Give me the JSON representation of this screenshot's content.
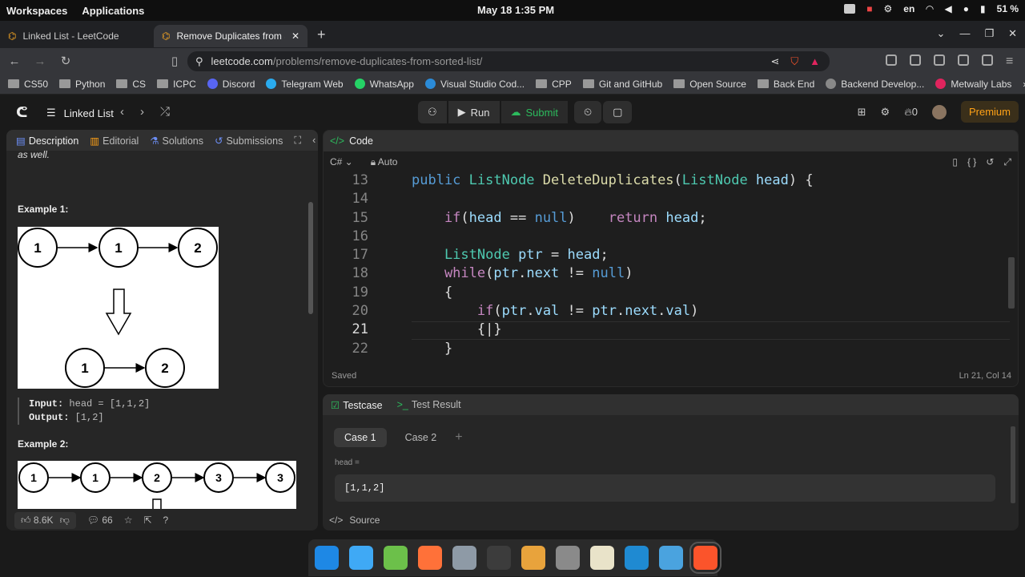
{
  "system": {
    "workspaces": "Workspaces",
    "applications": "Applications",
    "datetime": "May 18  1:35 PM",
    "lang": "en",
    "battery": "51 %"
  },
  "tabs": [
    {
      "title": "Linked List - LeetCode"
    },
    {
      "title": "Remove Duplicates from Sort"
    }
  ],
  "address": {
    "domain": "leetcode.com",
    "path": "/problems/remove-duplicates-from-sorted-list/"
  },
  "bookmarks": [
    {
      "label": "CS50",
      "icon": "folder"
    },
    {
      "label": "Python",
      "icon": "folder"
    },
    {
      "label": "CS",
      "icon": "folder"
    },
    {
      "label": "ICPC",
      "icon": "folder"
    },
    {
      "label": "Discord",
      "icon": "discord",
      "color": "#5865f2"
    },
    {
      "label": "Telegram Web",
      "icon": "telegram",
      "color": "#2aabee"
    },
    {
      "label": "WhatsApp",
      "icon": "whatsapp",
      "color": "#25d366"
    },
    {
      "label": "Visual Studio Cod...",
      "icon": "vscode",
      "color": "#2b8bd8"
    },
    {
      "label": "CPP",
      "icon": "folder"
    },
    {
      "label": "Git and GitHub",
      "icon": "folder"
    },
    {
      "label": "Open Source",
      "icon": "folder"
    },
    {
      "label": "Back End",
      "icon": "folder"
    },
    {
      "label": "Backend Develop...",
      "icon": "bd"
    },
    {
      "label": "Metwally Labs",
      "icon": "metwally",
      "color": "#e0245e"
    }
  ],
  "lc": {
    "list_label": "Linked List",
    "run": "Run",
    "submit": "Submit",
    "streak": "0",
    "premium": "Premium"
  },
  "left": {
    "tabs": [
      "Description",
      "Editorial",
      "Solutions",
      "Submissions"
    ],
    "text_top": "as well.",
    "ex1_title": "Example 1:",
    "ex1_nodes_top": [
      "1",
      "1",
      "2"
    ],
    "ex1_nodes_bottom": [
      "1",
      "2"
    ],
    "ex1_input_label": "Input:",
    "ex1_input": "head = [1,1,2]",
    "ex1_output_label": "Output:",
    "ex1_output": "[1,2]",
    "ex2_title": "Example 2:",
    "ex2_nodes": [
      "1",
      "1",
      "2",
      "3",
      "3"
    ],
    "likes": "8.6K",
    "comments": "66"
  },
  "code": {
    "header": "Code",
    "language": "C#",
    "mode": "Auto",
    "saved": "Saved",
    "position": "Ln 21, Col 14",
    "line_numbers": [
      "13",
      "14",
      "15",
      "16",
      "17",
      "18",
      "19",
      "20",
      "21",
      "22"
    ],
    "lines": [
      [
        {
          "t": "public ",
          "c": "kwb"
        },
        {
          "t": "ListNode ",
          "c": "ty"
        },
        {
          "t": "DeleteDuplicates",
          "c": "fn"
        },
        {
          "t": "(",
          "c": ""
        },
        {
          "t": "ListNode ",
          "c": "ty"
        },
        {
          "t": "head",
          "c": "vr"
        },
        {
          "t": ") {",
          "c": ""
        }
      ],
      [],
      [
        {
          "t": "    if",
          "c": "kw"
        },
        {
          "t": "(",
          "c": ""
        },
        {
          "t": "head",
          "c": "vr"
        },
        {
          "t": " == ",
          "c": ""
        },
        {
          "t": "null",
          "c": "kwb"
        },
        {
          "t": ")    ",
          "c": ""
        },
        {
          "t": "return ",
          "c": "kw"
        },
        {
          "t": "head",
          "c": "vr"
        },
        {
          "t": ";",
          "c": ""
        }
      ],
      [],
      [
        {
          "t": "    ListNode ",
          "c": "ty"
        },
        {
          "t": "ptr",
          "c": "vr"
        },
        {
          "t": " = ",
          "c": ""
        },
        {
          "t": "head",
          "c": "vr"
        },
        {
          "t": ";",
          "c": ""
        }
      ],
      [
        {
          "t": "    while",
          "c": "kw"
        },
        {
          "t": "(",
          "c": ""
        },
        {
          "t": "ptr",
          "c": "vr"
        },
        {
          "t": ".",
          "c": ""
        },
        {
          "t": "next",
          "c": "vr"
        },
        {
          "t": " != ",
          "c": ""
        },
        {
          "t": "null",
          "c": "kwb"
        },
        {
          "t": ")",
          "c": ""
        }
      ],
      [
        {
          "t": "    {",
          "c": ""
        }
      ],
      [
        {
          "t": "        if",
          "c": "kw"
        },
        {
          "t": "(",
          "c": ""
        },
        {
          "t": "ptr",
          "c": "vr"
        },
        {
          "t": ".",
          "c": ""
        },
        {
          "t": "val",
          "c": "vr"
        },
        {
          "t": " != ",
          "c": ""
        },
        {
          "t": "ptr",
          "c": "vr"
        },
        {
          "t": ".",
          "c": ""
        },
        {
          "t": "next",
          "c": "vr"
        },
        {
          "t": ".",
          "c": ""
        },
        {
          "t": "val",
          "c": "vr"
        },
        {
          "t": ")",
          "c": ""
        }
      ],
      [
        {
          "t": "        {|}",
          "c": ""
        }
      ],
      [
        {
          "t": "    }",
          "c": ""
        }
      ]
    ],
    "current_line": 8
  },
  "test": {
    "tab_testcase": "Testcase",
    "tab_result": "Test Result",
    "cases": [
      "Case 1",
      "Case 2"
    ],
    "label": "head =",
    "value": "[1,1,2]",
    "source": "Source"
  },
  "dock": [
    {
      "name": "search-app-icon",
      "color": "#1e88e5"
    },
    {
      "name": "software-center-icon",
      "color": "#3fa9f5"
    },
    {
      "name": "app-grid-icon",
      "color": "#6cc04a"
    },
    {
      "name": "firefox-icon",
      "color": "#ff7139"
    },
    {
      "name": "files-icon",
      "color": "#8e9aa6"
    },
    {
      "name": "terminal-icon",
      "color": "#3c3c3c"
    },
    {
      "name": "store-icon",
      "color": "#e8a33c"
    },
    {
      "name": "settings-icon",
      "color": "#8a8a8a"
    },
    {
      "name": "text-editor-icon",
      "color": "#e9e3c9"
    },
    {
      "name": "vscode-icon",
      "color": "#1f8ad2"
    },
    {
      "name": "tools-icon",
      "color": "#4aa3df"
    },
    {
      "name": "brave-icon",
      "color": "#fb542b"
    }
  ],
  "colors": {
    "accent": "#ffa116",
    "submit": "#2cbb5d",
    "bg": "#1a1a1a"
  }
}
